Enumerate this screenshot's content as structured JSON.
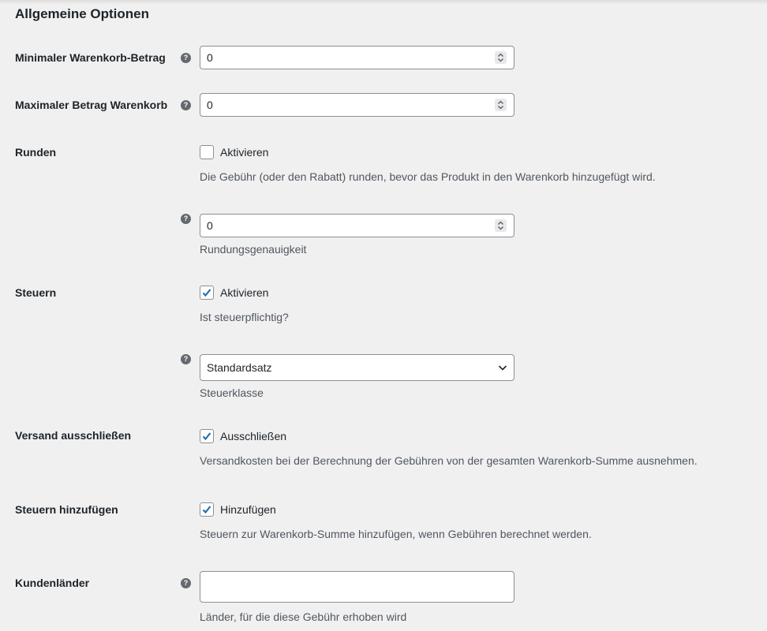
{
  "section": {
    "title": "Allgemeine Optionen"
  },
  "min_cart": {
    "label": "Minimaler Warenkorb-Betrag",
    "value": "0"
  },
  "max_cart": {
    "label": "Maximaler Betrag Warenkorb",
    "value": "0"
  },
  "rounding": {
    "label": "Runden",
    "checkbox_label": "Aktivieren",
    "checked": false,
    "description": "Die Gebühr (oder den Rabatt) runden, bevor das Produkt in den Warenkorb hinzugefügt wird.",
    "precision_value": "0",
    "precision_caption": "Rundungsgenauigkeit"
  },
  "taxes": {
    "label": "Steuern",
    "checkbox_label": "Aktivieren",
    "checked": true,
    "description": "Ist steuerpflichtig?",
    "tax_class_value": "Standardsatz",
    "tax_class_caption": "Steuerklasse"
  },
  "exclude_shipping": {
    "label": "Versand ausschließen",
    "checkbox_label": "Ausschließen",
    "checked": true,
    "description": "Versandkosten bei der Berechnung der Gebühren von der gesamten Warenkorb-Summe ausnehmen."
  },
  "add_taxes": {
    "label": "Steuern hinzufügen",
    "checkbox_label": "Hinzufügen",
    "checked": true,
    "description": "Steuern zur Warenkorb-Summe hinzufügen, wenn Gebühren berechnet werden."
  },
  "customer_countries": {
    "label": "Kundenländer",
    "value": "",
    "description": "Länder, für die diese Gebühr erhoben wird"
  },
  "help_glyph": "?",
  "colors": {
    "checkmark": "#2271b1",
    "help_icon": "#646970"
  }
}
